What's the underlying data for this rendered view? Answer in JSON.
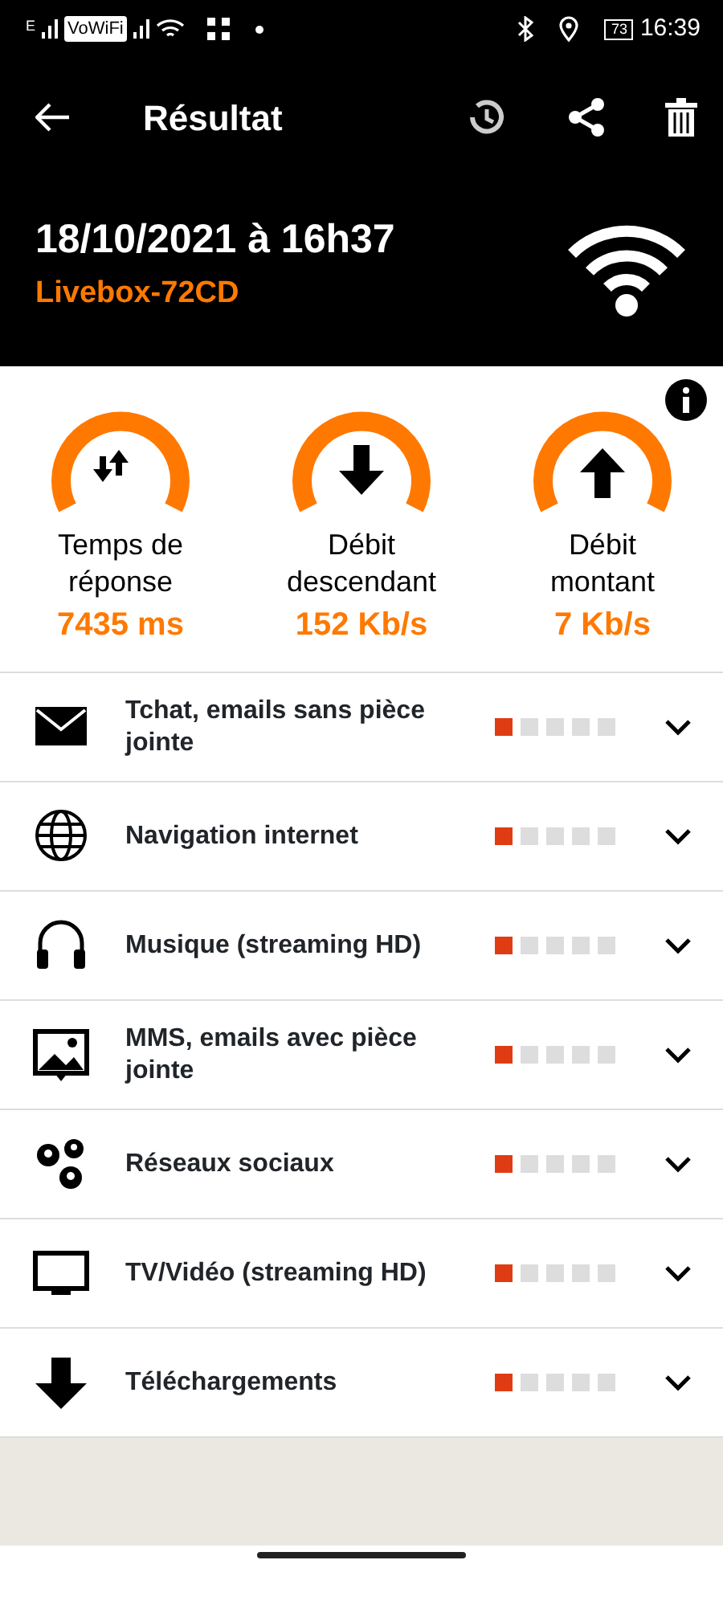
{
  "status_bar": {
    "network": "E",
    "wifi_calling": "VoWiFi",
    "battery": "73",
    "time": "16:39"
  },
  "toolbar": {
    "title": "Résultat"
  },
  "header": {
    "date": "18/10/2021 à 16h37",
    "network_name": "Livebox-72CD"
  },
  "metrics": [
    {
      "kind": "latency",
      "label": "Temps de réponse",
      "value": "7435 ms"
    },
    {
      "kind": "download",
      "label": "Débit descendant",
      "value": "152 Kb/s"
    },
    {
      "kind": "upload",
      "label": "Débit montant",
      "value": "7 Kb/s"
    }
  ],
  "usages": [
    {
      "kind": "mail",
      "label": "Tchat, emails sans pièce jointe",
      "stars": 1,
      "expanded": false
    },
    {
      "kind": "globe",
      "label": "Navigation internet",
      "stars": 1,
      "expanded": false
    },
    {
      "kind": "headphones",
      "label": "Musique (streaming HD)",
      "stars": 1,
      "expanded": false
    },
    {
      "kind": "image",
      "label": "MMS, emails avec pièce jointe",
      "stars": 1,
      "expanded": false
    },
    {
      "kind": "social",
      "label": "Réseaux sociaux",
      "stars": 1,
      "expanded": false
    },
    {
      "kind": "tv",
      "label": "TV/Vidéo (streaming HD)",
      "stars": 1,
      "expanded": false
    },
    {
      "kind": "download",
      "label": "Téléchargements",
      "stars": 1,
      "expanded": false
    }
  ]
}
